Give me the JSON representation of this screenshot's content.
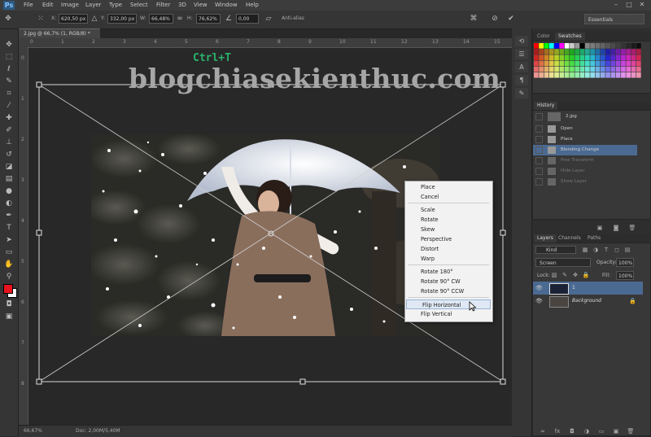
{
  "app": {
    "logo": "Ps",
    "menus": [
      "File",
      "Edit",
      "Image",
      "Layer",
      "Type",
      "Select",
      "Filter",
      "3D",
      "View",
      "Window",
      "Help"
    ]
  },
  "options": {
    "x_label": "X:",
    "x_value": "620,50 px",
    "y_label": "Y:",
    "y_value": "332,00 px",
    "w_label": "W:",
    "w_value": "66,48%",
    "h_label": "H:",
    "h_value": "76,62%",
    "angle_value": "0,00",
    "interp_label": "Anti-alias",
    "workspace": "Essentials"
  },
  "document": {
    "tab": "2.jpg @ 66,7% (1, RGB/8) *",
    "zoom": "66,67%",
    "doc_size": "Doc: 2,00M/5,40M",
    "ruler_top": [
      "0",
      "1",
      "2",
      "3",
      "4",
      "5",
      "6",
      "7",
      "8",
      "9",
      "10",
      "11",
      "12",
      "13",
      "14",
      "15"
    ],
    "ruler_left": [
      "0",
      "1",
      "2",
      "3",
      "4",
      "5",
      "6",
      "7",
      "8"
    ]
  },
  "overlay": {
    "shortcut": "Ctrl+T",
    "watermark": "blogchiasekienthuc.com"
  },
  "context_menu": {
    "items": [
      {
        "label": "Place"
      },
      {
        "label": "Cancel"
      },
      {
        "label": "Scale"
      },
      {
        "label": "Rotate"
      },
      {
        "label": "Skew"
      },
      {
        "label": "Perspective"
      },
      {
        "label": "Distort"
      },
      {
        "label": "Warp"
      },
      {
        "label": "Rotate 180°"
      },
      {
        "label": "Rotate 90° CW"
      },
      {
        "label": "Rotate 90° CCW"
      },
      {
        "label": "Flip Horizontal"
      },
      {
        "label": "Flip Vertical"
      }
    ],
    "highlighted": "Flip Horizontal"
  },
  "panels": {
    "color_tabs": [
      "Color",
      "Swatches"
    ],
    "history_tab": "History",
    "history_snapshot": "2.jpg",
    "history_items": [
      "Open",
      "Place",
      "Blending Change",
      "Free Transform",
      "Hide Layer",
      "Show Layer"
    ],
    "layers_tabs": [
      "Layers",
      "Channels",
      "Paths"
    ],
    "kind_label": "Kind",
    "blend_mode": "Screen",
    "opacity_label": "Opacity:",
    "opacity_value": "100%",
    "lock_label": "Lock:",
    "fill_label": "Fill:",
    "fill_value": "100%",
    "layers": [
      {
        "name": "1"
      },
      {
        "name": "Background"
      }
    ]
  },
  "colors": {
    "foreground": "#e8141e",
    "background": "#ffffff",
    "highlight": "#dfe8f4",
    "watermark": "#a6a6a6",
    "shortcut": "#29b36b"
  }
}
